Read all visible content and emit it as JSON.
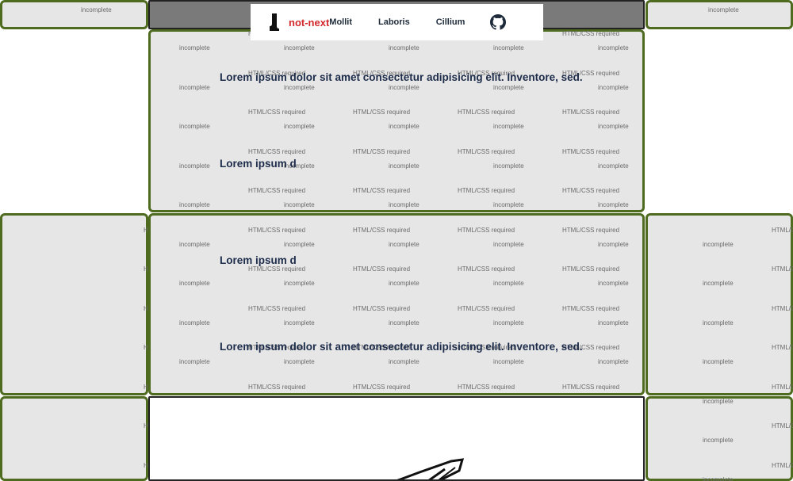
{
  "watermarks": {
    "required": "HTML/CSS required",
    "incomplete": "incomplete"
  },
  "navbar": {
    "brand": "not-next",
    "links": [
      "Mollit",
      "Laboris",
      "Cillium"
    ],
    "github_icon": "github-icon"
  },
  "headings": {
    "long": "Lorem ipsum dolor sit amet consectetur adipisicing elit. Inventore, sed.",
    "short": "Lorem ipsum d"
  },
  "colors": {
    "panel_bg": "#e6e6e6",
    "panel_border": "#4f6b1f",
    "brand_red": "#d2262b",
    "heading": "#1d2c4a"
  }
}
